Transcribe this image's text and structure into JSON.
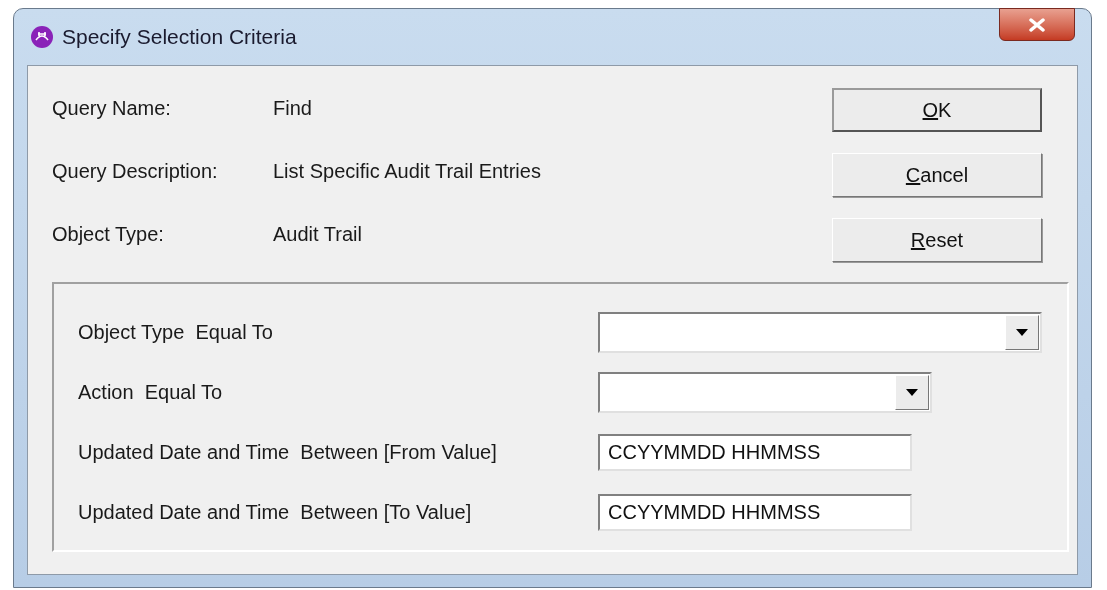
{
  "window": {
    "title": "Specify Selection Criteria"
  },
  "info": [
    {
      "label": "Query Name:",
      "value": "Find"
    },
    {
      "label": "Query Description:",
      "value": "List Specific Audit Trail Entries"
    },
    {
      "label": "Object Type:",
      "value": "Audit Trail"
    }
  ],
  "buttons": [
    {
      "label": "OK",
      "default": true
    },
    {
      "label": "Cancel",
      "default": false
    },
    {
      "label": "Reset",
      "default": false
    }
  ],
  "criteria": [
    {
      "kind": "dropdown",
      "label": "Object Type  Equal To"
    },
    {
      "kind": "dropdown",
      "label": "Action  Equal To"
    },
    {
      "kind": "text",
      "label": "Updated Date and Time  Between [From Value]",
      "value": "CCYYMMDD HHMMSS"
    },
    {
      "kind": "text",
      "label": "Updated Date and Time  Between [To Value]",
      "value": "CCYYMMDD HHMMSS"
    }
  ]
}
